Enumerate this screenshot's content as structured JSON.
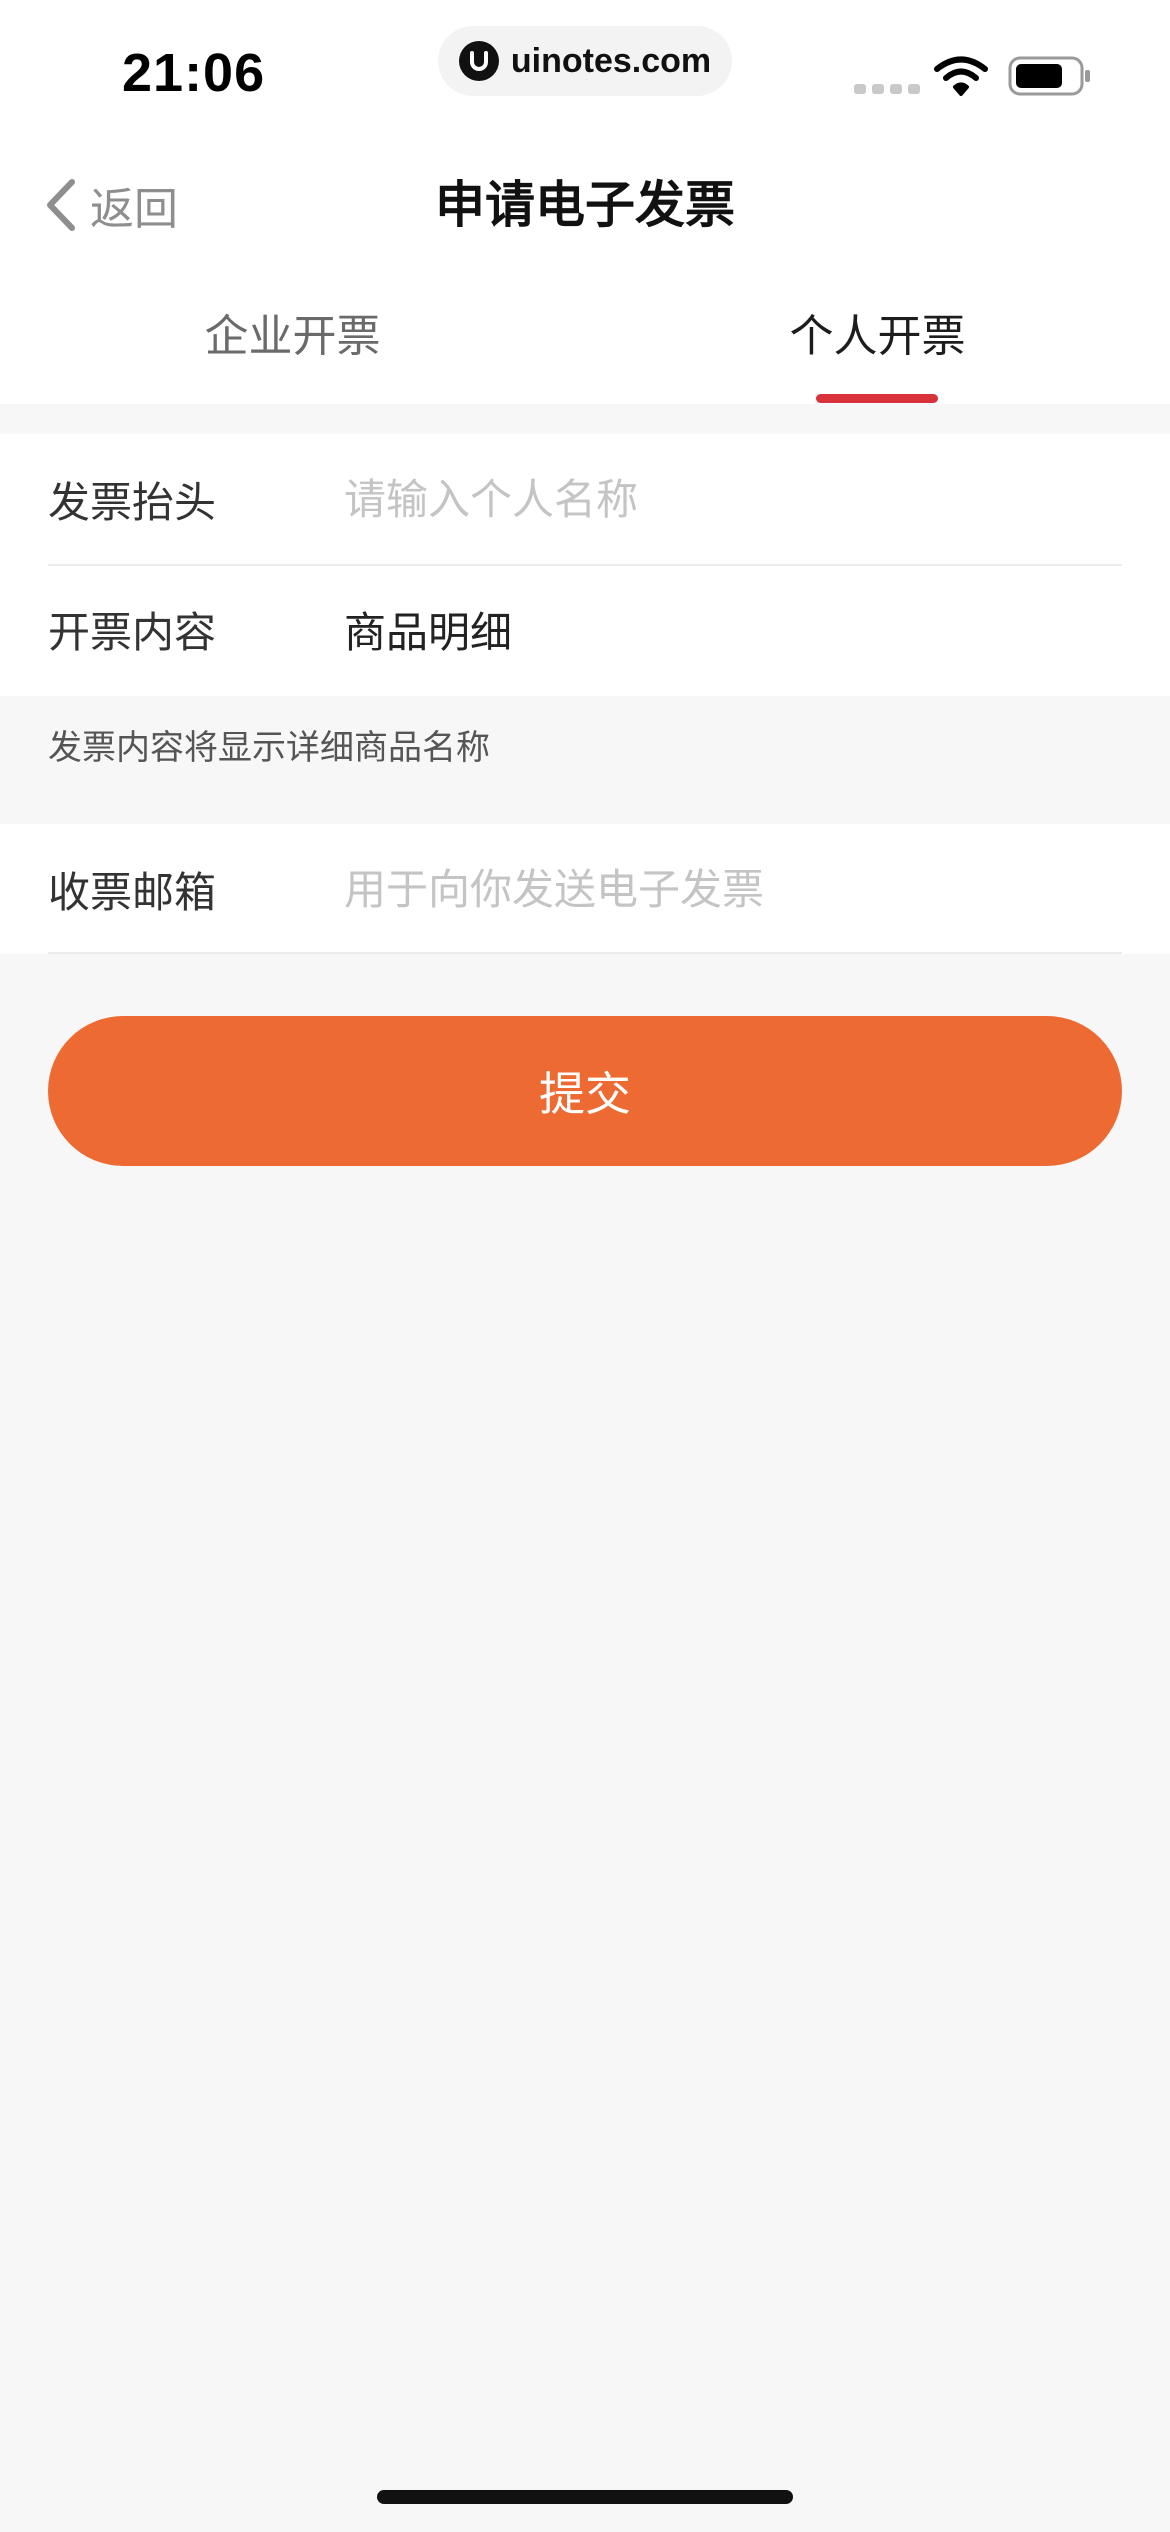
{
  "status_bar": {
    "time": "21:06",
    "url": "uinotes.com",
    "icons": [
      "signal-icon",
      "wifi-icon",
      "battery-icon"
    ]
  },
  "nav": {
    "back_label": "返回",
    "title": "申请电子发票"
  },
  "tabs": [
    {
      "label": "企业开票",
      "active": false
    },
    {
      "label": "个人开票",
      "active": true
    }
  ],
  "form": {
    "invoice_title": {
      "label": "发票抬头",
      "placeholder": "请输入个人名称",
      "value": ""
    },
    "invoice_content": {
      "label": "开票内容",
      "value": "商品明细"
    },
    "hint": "发票内容将显示详细商品名称",
    "email": {
      "label": "收票邮箱",
      "placeholder": "用于向你发送电子发票",
      "value": ""
    }
  },
  "submit_label": "提交",
  "colors": {
    "accent": "#ed6b33",
    "tab_indicator": "#d8333a",
    "background": "#f7f7f7"
  }
}
